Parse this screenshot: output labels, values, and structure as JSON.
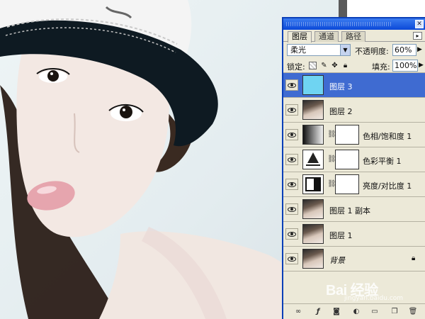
{
  "palette": {
    "tabs": [
      "图层",
      "通道",
      "路径"
    ],
    "blend_mode": "柔光",
    "opacity_label": "不透明度:",
    "opacity_value": "60%",
    "lock_label": "锁定:",
    "fill_label": "填充:",
    "fill_value": "100%",
    "layers": [
      {
        "name": "图层 3",
        "thumb": "cyan-fill",
        "selected": true
      },
      {
        "name": "图层 2",
        "thumb": "photo"
      },
      {
        "name": "色相/饱和度 1",
        "thumb": "hue-saturation-adjustment"
      },
      {
        "name": "色彩平衡 1",
        "thumb": "color-balance-adjustment"
      },
      {
        "name": "亮度/对比度 1",
        "thumb": "brightness-contrast-adjustment"
      },
      {
        "name": "图层 1 副本",
        "thumb": "photo"
      },
      {
        "name": "图层 1",
        "thumb": "photo"
      },
      {
        "name": "背景",
        "thumb": "photo",
        "locked": true
      }
    ],
    "bottom_icons": [
      "link-icon",
      "layer-style-icon",
      "mask-icon",
      "adjustment-icon",
      "folder-icon",
      "new-layer-icon",
      "trash-icon"
    ]
  },
  "watermark": {
    "text": "Bai 经验",
    "sub": "jingyan.baidu.com"
  },
  "colors": {
    "title_bar": "#0a48d8",
    "selected_layer": "#3f6bd1",
    "cyan_layer": "#6fd4f2",
    "panel_bg": "#ece9d8"
  }
}
